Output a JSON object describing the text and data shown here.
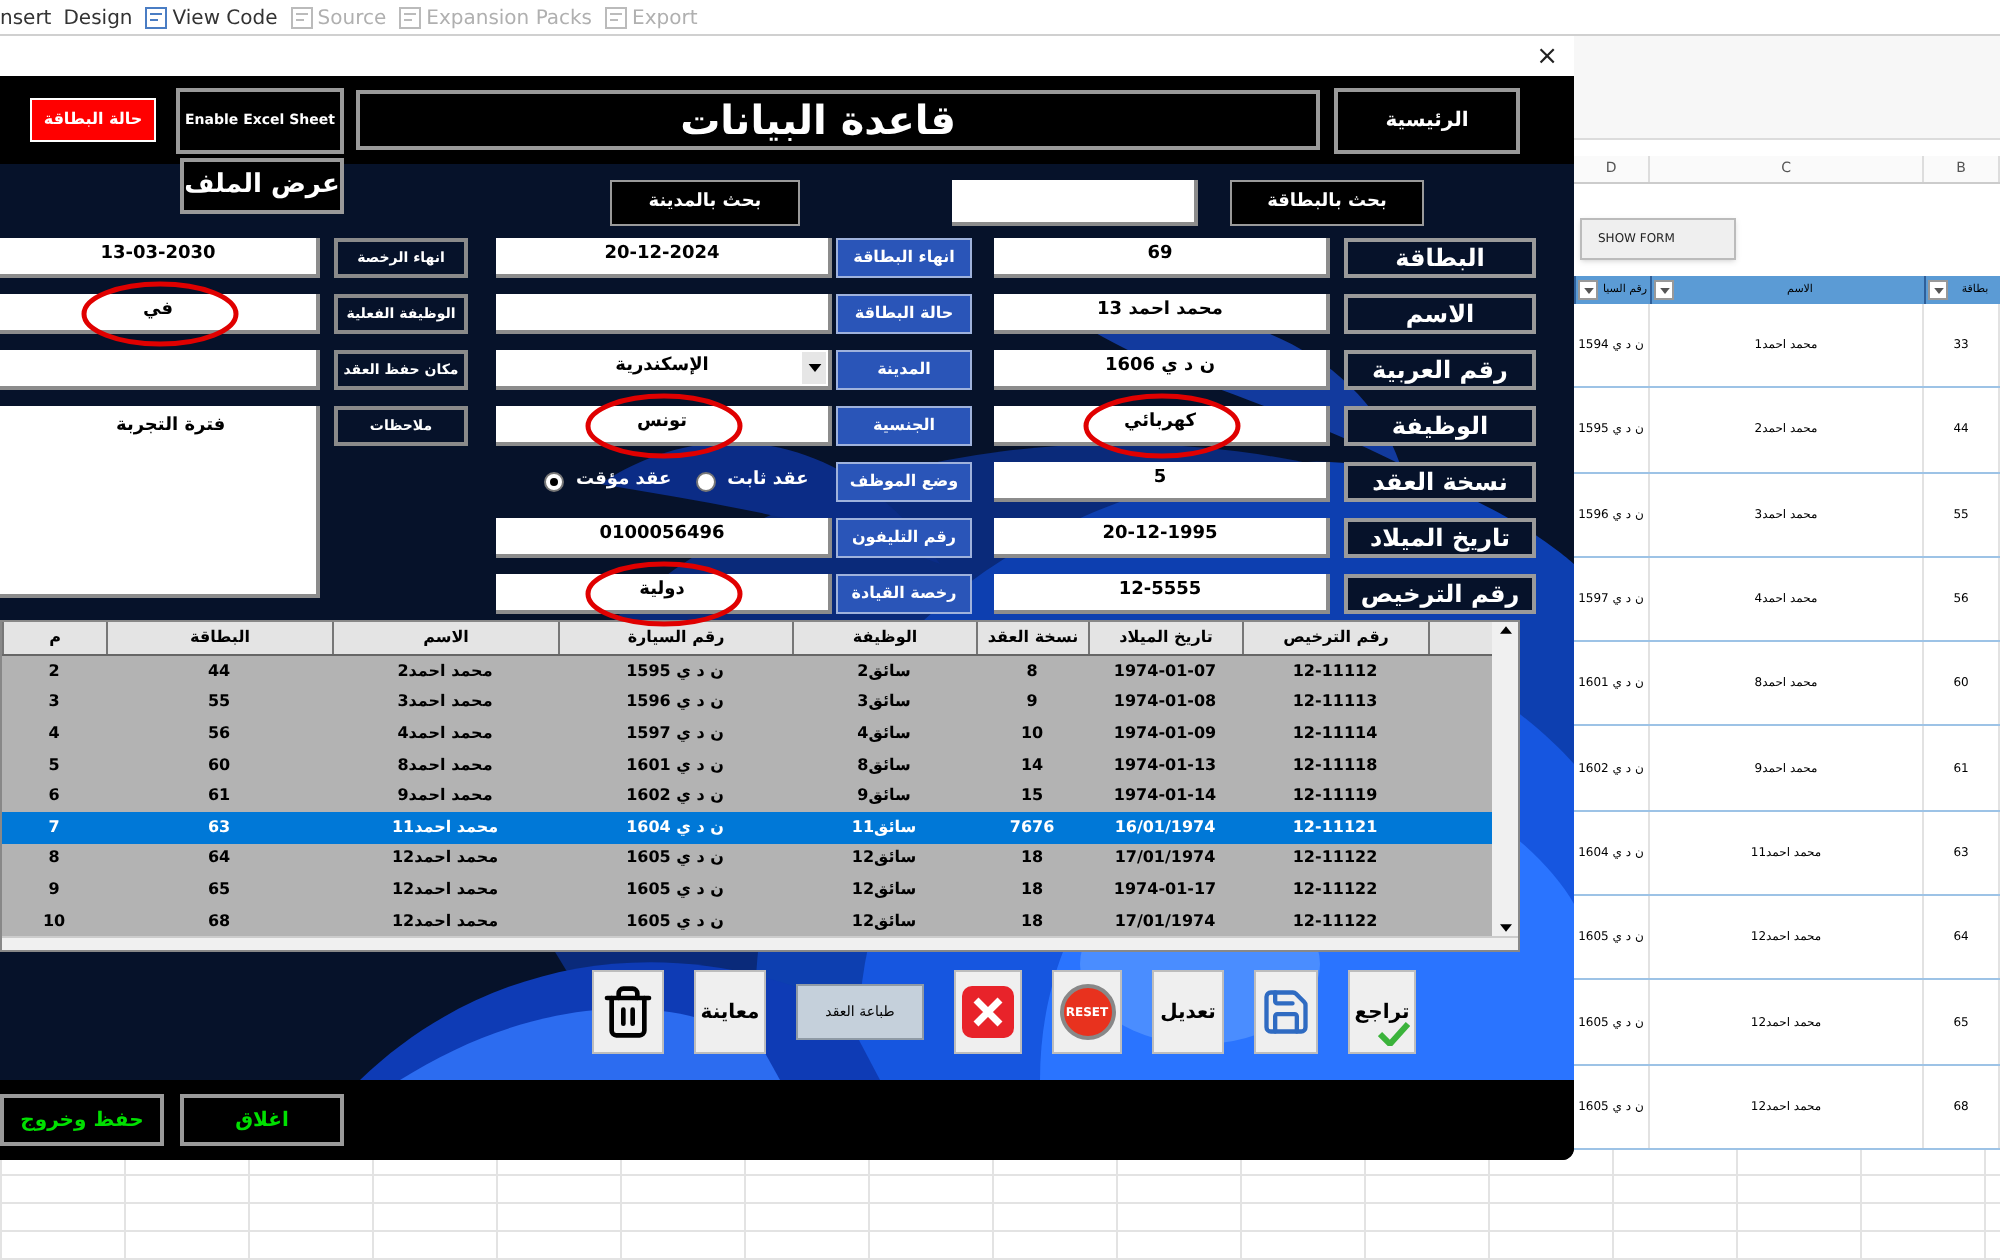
{
  "ribbon": [
    {
      "label": "Export",
      "disabled": true
    },
    {
      "label": "Expansion Packs",
      "disabled": true
    },
    {
      "label": "Source",
      "disabled": true
    },
    {
      "label": "View Code",
      "disabled": false
    },
    {
      "label": "Design",
      "disabled": false
    },
    {
      "label": "nsert",
      "disabled": false
    }
  ],
  "form": {
    "close": "×",
    "card_status_button": "حالة البطاقة",
    "enable_excel_button": "Enable Excel Sheet",
    "title": "قاعدة البيانات",
    "home_button": "الرئيسية",
    "view_file_button": "عرض الملف",
    "city_search_button": "بحث بالمدينة",
    "card_search_button": "بحث بالبطاقة",
    "right_fields": [
      {
        "label": "البطاقة",
        "kind": "text",
        "value": "69",
        "circled": false
      },
      {
        "label": "الاسم",
        "kind": "text",
        "value": "محمد احمد 13",
        "circled": false
      },
      {
        "label": "رقم العربية",
        "kind": "text",
        "value": "ن د ي 1606",
        "circled": false
      },
      {
        "label": "الوظيفة",
        "kind": "text",
        "value": "كهربائي",
        "circled": true
      },
      {
        "label": "نسخة العقد",
        "kind": "text",
        "value": "5",
        "circled": false
      },
      {
        "label": "تاريخ الميلاد",
        "kind": "text",
        "value": "20-12-1995",
        "circled": false
      },
      {
        "label": "رقم الترخيص",
        "kind": "text",
        "value": "12-5555",
        "circled": false
      }
    ],
    "middle_fields": [
      {
        "label": "انهاء البطاقة",
        "kind": "text",
        "value": "20-12-2024",
        "circled": false
      },
      {
        "label": "حالة البطاقة",
        "kind": "text",
        "circled": false
      },
      {
        "label": "المدينة",
        "kind": "dropdown",
        "value": "الإسكندرية",
        "circled": false
      },
      {
        "label": "الجنسية",
        "kind": "text",
        "value": "تونس",
        "circled": true
      },
      {
        "label": "وضع الموظف",
        "kind": "radio",
        "circled": false,
        "options": [
          {
            "label": "عقد ثابت",
            "selected": false
          },
          {
            "label": "عقد مؤقت",
            "selected": true
          }
        ]
      },
      {
        "label": "رقم التليفون",
        "kind": "text",
        "value": "0100056496",
        "circled": false
      },
      {
        "label": "رخصة القيادة",
        "kind": "text",
        "value": "دولية",
        "circled": true
      }
    ],
    "left_fields": [
      {
        "label": "انهاء الرخصة",
        "kind": "text",
        "value": "13-03-2030",
        "circled": false
      },
      {
        "label": "الوظيفة الفعلية",
        "kind": "text",
        "value": "في",
        "circled": true
      },
      {
        "label": "مكان حفظ العقد",
        "kind": "text",
        "circled": false
      },
      {
        "label": "ملاحظات",
        "kind": "textarea",
        "value": "فترة التجربة",
        "circled": false
      }
    ],
    "table": {
      "columns": [
        "رقم الترخيص",
        "تاريخ الميلاد",
        "نسخة العقد",
        "الوظيفة",
        "رقم السيارة",
        "الاسم",
        "البطاقة",
        "م"
      ],
      "rows": [
        {
          "selected": false,
          "cells": [
            "12-11112",
            "1974-01-07",
            "8",
            "سائق2",
            "ن د ي 1595",
            "محمد احمد2",
            "44",
            "2"
          ]
        },
        {
          "selected": false,
          "cells": [
            "12-11113",
            "1974-01-08",
            "9",
            "سائق3",
            "ن د ي 1596",
            "محمد احمد3",
            "55",
            "3"
          ]
        },
        {
          "selected": false,
          "cells": [
            "12-11114",
            "1974-01-09",
            "10",
            "سائق4",
            "ن د ي 1597",
            "محمد احمد4",
            "56",
            "4"
          ]
        },
        {
          "selected": false,
          "cells": [
            "12-11118",
            "1974-01-13",
            "14",
            "سائق8",
            "ن د ي 1601",
            "محمد احمد8",
            "60",
            "5"
          ]
        },
        {
          "selected": false,
          "cells": [
            "12-11119",
            "1974-01-14",
            "15",
            "سائق9",
            "ن د ي 1602",
            "محمد احمد9",
            "61",
            "6"
          ]
        },
        {
          "selected": true,
          "cells": [
            "12-11121",
            "16/01/1974",
            "7676",
            "سائق11",
            "ن د ي 1604",
            "محمد احمد11",
            "63",
            "7"
          ]
        },
        {
          "selected": false,
          "cells": [
            "12-11122",
            "17/01/1974",
            "18",
            "سائق12",
            "ن د ي 1605",
            "محمد احمد12",
            "64",
            "8"
          ]
        },
        {
          "selected": false,
          "cells": [
            "12-11122",
            "1974-01-17",
            "18",
            "سائق12",
            "ن د ي 1605",
            "محمد احمد12",
            "65",
            "9"
          ]
        },
        {
          "selected": false,
          "cells": [
            "12-11122",
            "17/01/1974",
            "18",
            "سائق12",
            "ن د ي 1605",
            "محمد احمد12",
            "68",
            "10"
          ]
        }
      ]
    },
    "actions": [
      {
        "kind": "review",
        "label": "تراجع"
      },
      {
        "kind": "save"
      },
      {
        "kind": "text",
        "label": "تعديل"
      },
      {
        "kind": "reset",
        "label": "RESET"
      },
      {
        "kind": "cancel"
      },
      {
        "kind": "print",
        "label": "طباعة العقد"
      },
      {
        "kind": "text",
        "label": "معاينة"
      },
      {
        "kind": "delete"
      }
    ],
    "footer_buttons": [
      "اغلاق",
      "حفظ وخروج"
    ]
  },
  "sheet": {
    "column_letters": [
      "B",
      "C",
      "D"
    ],
    "show_form_button": "SHOW FORM",
    "headers": [
      "بطاقة",
      "الاسم",
      "رقم السيا"
    ],
    "rows": [
      [
        "33",
        "محمد احمد1",
        "ن د ي 1594"
      ],
      [
        "44",
        "محمد احمد2",
        "ن د ي 1595"
      ],
      [
        "55",
        "محمد احمد3",
        "ن د ي 1596"
      ],
      [
        "56",
        "محمد احمد4",
        "ن د ي 1597"
      ],
      [
        "60",
        "محمد احمد8",
        "ن د ي 1601"
      ],
      [
        "61",
        "محمد احمد9",
        "ن د ي 1602"
      ],
      [
        "63",
        "محمد احمد11",
        "ن د ي 1604"
      ],
      [
        "64",
        "محمد احمد12",
        "ن د ي 1605"
      ],
      [
        "65",
        "محمد احمد12",
        "ن د ي 1605"
      ],
      [
        "68",
        "محمد احمد12",
        "ن د ي 1605"
      ]
    ]
  }
}
